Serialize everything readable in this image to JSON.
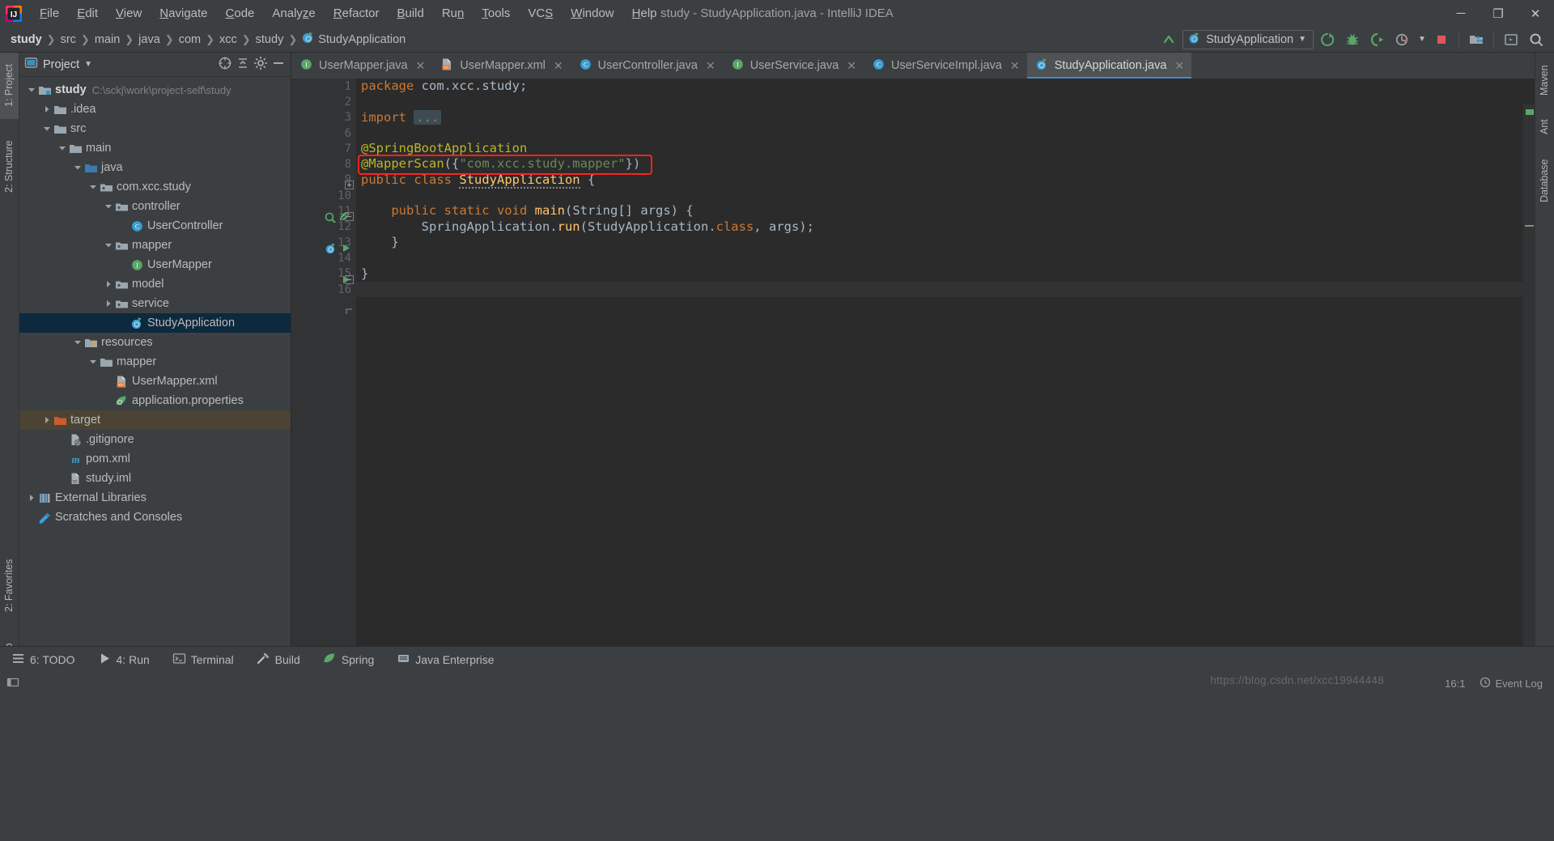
{
  "window": {
    "title": "study - StudyApplication.java - IntelliJ IDEA",
    "minimize": "─",
    "maximize": "❐",
    "close": "✕"
  },
  "menu": [
    {
      "label": "File",
      "mnemonic": "F"
    },
    {
      "label": "Edit",
      "mnemonic": "E"
    },
    {
      "label": "View",
      "mnemonic": "V"
    },
    {
      "label": "Navigate",
      "mnemonic": "N"
    },
    {
      "label": "Code",
      "mnemonic": "C"
    },
    {
      "label": "Analyze",
      "mnemonic": "z"
    },
    {
      "label": "Refactor",
      "mnemonic": "R"
    },
    {
      "label": "Build",
      "mnemonic": "B"
    },
    {
      "label": "Run",
      "mnemonic": "n"
    },
    {
      "label": "Tools",
      "mnemonic": "T"
    },
    {
      "label": "VCS",
      "mnemonic": "S"
    },
    {
      "label": "Window",
      "mnemonic": "W"
    },
    {
      "label": "Help",
      "mnemonic": "H"
    }
  ],
  "breadcrumbs": [
    {
      "label": "study",
      "icon": ""
    },
    {
      "label": "src",
      "icon": ""
    },
    {
      "label": "main",
      "icon": ""
    },
    {
      "label": "java",
      "icon": ""
    },
    {
      "label": "com",
      "icon": ""
    },
    {
      "label": "xcc",
      "icon": ""
    },
    {
      "label": "study",
      "icon": ""
    },
    {
      "label": "StudyApplication",
      "icon": "spring-boot-class-icon"
    }
  ],
  "toolbar": {
    "run_config": "StudyApplication",
    "icons": [
      {
        "name": "update-project-icon"
      },
      {
        "name": "run-icon"
      },
      {
        "name": "debug-icon"
      },
      {
        "name": "run-with-coverage-icon"
      },
      {
        "name": "profiler-icon"
      },
      {
        "name": "stop-icon"
      },
      {
        "name": "project-structure-icon"
      },
      {
        "name": "hide-windows-icon"
      },
      {
        "name": "search-everywhere-icon"
      }
    ]
  },
  "left_stripe": [
    {
      "label": "1: Project",
      "active": true
    },
    {
      "label": "2: Structure",
      "active": false
    },
    {
      "label": "2: Favorites",
      "active": false
    },
    {
      "label": "Web",
      "active": false
    }
  ],
  "right_stripe": [
    {
      "label": "Maven"
    },
    {
      "label": "Ant"
    },
    {
      "label": "Database"
    }
  ],
  "project_panel": {
    "title": "Project",
    "header_icons": [
      {
        "name": "select-opened-file-icon"
      },
      {
        "name": "collapse-all-icon"
      },
      {
        "name": "settings-gear-icon"
      },
      {
        "name": "hide-panel-icon"
      }
    ],
    "tree": [
      {
        "label": "study",
        "path": "C:\\sckj\\work\\project-self\\study",
        "indent": 0,
        "arrow": "open",
        "icon": "module-folder-icon",
        "bold": true,
        "state": "normal"
      },
      {
        "label": ".idea",
        "path": "",
        "indent": 1,
        "arrow": "closed",
        "icon": "folder-icon",
        "bold": false,
        "state": "normal"
      },
      {
        "label": "src",
        "path": "",
        "indent": 1,
        "arrow": "open",
        "icon": "folder-icon",
        "bold": false,
        "state": "normal"
      },
      {
        "label": "main",
        "path": "",
        "indent": 2,
        "arrow": "open",
        "icon": "folder-icon",
        "bold": false,
        "state": "normal"
      },
      {
        "label": "java",
        "path": "",
        "indent": 3,
        "arrow": "open",
        "icon": "source-root-icon",
        "bold": false,
        "state": "normal"
      },
      {
        "label": "com.xcc.study",
        "path": "",
        "indent": 4,
        "arrow": "open",
        "icon": "package-icon",
        "bold": false,
        "state": "normal"
      },
      {
        "label": "controller",
        "path": "",
        "indent": 5,
        "arrow": "open",
        "icon": "package-icon",
        "bold": false,
        "state": "normal"
      },
      {
        "label": "UserController",
        "path": "",
        "indent": 6,
        "arrow": "none",
        "icon": "class-icon",
        "bold": false,
        "state": "normal"
      },
      {
        "label": "mapper",
        "path": "",
        "indent": 5,
        "arrow": "open",
        "icon": "package-icon",
        "bold": false,
        "state": "normal"
      },
      {
        "label": "UserMapper",
        "path": "",
        "indent": 6,
        "arrow": "none",
        "icon": "interface-icon",
        "bold": false,
        "state": "normal"
      },
      {
        "label": "model",
        "path": "",
        "indent": 5,
        "arrow": "closed",
        "icon": "package-icon",
        "bold": false,
        "state": "normal"
      },
      {
        "label": "service",
        "path": "",
        "indent": 5,
        "arrow": "closed",
        "icon": "package-icon",
        "bold": false,
        "state": "normal"
      },
      {
        "label": "StudyApplication",
        "path": "",
        "indent": 6,
        "arrow": "none",
        "icon": "spring-boot-class-icon",
        "bold": false,
        "state": "selected"
      },
      {
        "label": "resources",
        "path": "",
        "indent": 3,
        "arrow": "open",
        "icon": "resource-root-icon",
        "bold": false,
        "state": "normal"
      },
      {
        "label": "mapper",
        "path": "",
        "indent": 4,
        "arrow": "open",
        "icon": "folder-icon",
        "bold": false,
        "state": "normal"
      },
      {
        "label": "UserMapper.xml",
        "path": "",
        "indent": 5,
        "arrow": "none",
        "icon": "xml-file-icon",
        "bold": false,
        "state": "normal"
      },
      {
        "label": "application.properties",
        "path": "",
        "indent": 5,
        "arrow": "none",
        "icon": "spring-properties-icon",
        "bold": false,
        "state": "normal"
      },
      {
        "label": "target",
        "path": "",
        "indent": 1,
        "arrow": "closed",
        "icon": "excluded-folder-icon",
        "bold": false,
        "state": "excluded"
      },
      {
        "label": ".gitignore",
        "path": "",
        "indent": 2,
        "arrow": "none",
        "icon": "gitignore-file-icon",
        "bold": false,
        "state": "normal"
      },
      {
        "label": "pom.xml",
        "path": "",
        "indent": 2,
        "arrow": "none",
        "icon": "maven-file-icon",
        "bold": false,
        "state": "normal"
      },
      {
        "label": "study.iml",
        "path": "",
        "indent": 2,
        "arrow": "none",
        "icon": "iml-file-icon",
        "bold": false,
        "state": "normal"
      },
      {
        "label": "External Libraries",
        "path": "",
        "indent": 0,
        "arrow": "closed",
        "icon": "libraries-icon",
        "bold": false,
        "state": "normal"
      },
      {
        "label": "Scratches and Consoles",
        "path": "",
        "indent": 0,
        "arrow": "none",
        "icon": "scratches-icon",
        "bold": false,
        "state": "normal"
      }
    ]
  },
  "tabs": [
    {
      "label": "UserMapper.java",
      "icon": "interface-icon",
      "active": false
    },
    {
      "label": "UserMapper.xml",
      "icon": "xml-file-icon",
      "active": false
    },
    {
      "label": "UserController.java",
      "icon": "class-icon",
      "active": false
    },
    {
      "label": "UserService.java",
      "icon": "interface-icon",
      "active": false
    },
    {
      "label": "UserServiceImpl.java",
      "icon": "class-icon",
      "active": false
    },
    {
      "label": "StudyApplication.java",
      "icon": "spring-boot-class-icon",
      "active": true
    }
  ],
  "editor": {
    "line_numbers": [
      "1",
      "2",
      "3",
      "6",
      "7",
      "8",
      "9",
      "10",
      "11",
      "12",
      "13",
      "14",
      "15",
      "16"
    ],
    "lines": [
      {
        "n": "1",
        "tokens": [
          {
            "t": "package",
            "c": "kw"
          },
          {
            "t": " com.xcc.study;",
            "c": "plain"
          }
        ]
      },
      {
        "n": "2",
        "tokens": []
      },
      {
        "n": "3",
        "tokens": [
          {
            "t": "import",
            "c": "kw"
          },
          {
            "t": " ",
            "c": "plain"
          },
          {
            "t": "...",
            "c": "folded"
          }
        ]
      },
      {
        "n": "6",
        "tokens": []
      },
      {
        "n": "7",
        "tokens": [
          {
            "t": "@SpringBootApplication",
            "c": "anno"
          }
        ]
      },
      {
        "n": "8",
        "tokens": [
          {
            "t": "@MapperScan",
            "c": "anno"
          },
          {
            "t": "({",
            "c": "plain"
          },
          {
            "t": "\"com.xcc.study.mapper\"",
            "c": "str"
          },
          {
            "t": "})",
            "c": "plain"
          }
        ]
      },
      {
        "n": "9",
        "tokens": [
          {
            "t": "public class",
            "c": "kw"
          },
          {
            "t": " ",
            "c": "plain"
          },
          {
            "t": "StudyApplication",
            "c": "kw2"
          },
          {
            "t": " {",
            "c": "plain"
          }
        ]
      },
      {
        "n": "10",
        "tokens": []
      },
      {
        "n": "11",
        "tokens": [
          {
            "t": "    ",
            "c": "plain"
          },
          {
            "t": "public static void",
            "c": "kw"
          },
          {
            "t": " ",
            "c": "plain"
          },
          {
            "t": "main",
            "c": "kw2"
          },
          {
            "t": "(",
            "c": "plain"
          },
          {
            "t": "String",
            "c": "cls"
          },
          {
            "t": "[] ",
            "c": "plain"
          },
          {
            "t": "args",
            "c": "param"
          },
          {
            "t": ") {",
            "c": "plain"
          }
        ]
      },
      {
        "n": "12",
        "tokens": [
          {
            "t": "        SpringApplication.",
            "c": "plain"
          },
          {
            "t": "run",
            "c": "kw2"
          },
          {
            "t": "(StudyApplication.",
            "c": "plain"
          },
          {
            "t": "class",
            "c": "kw"
          },
          {
            "t": ", ",
            "c": "plain"
          },
          {
            "t": "args",
            "c": "param"
          },
          {
            "t": ");",
            "c": "plain"
          }
        ]
      },
      {
        "n": "13",
        "tokens": [
          {
            "t": "    }",
            "c": "plain"
          }
        ]
      },
      {
        "n": "14",
        "tokens": []
      },
      {
        "n": "15",
        "tokens": [
          {
            "t": "}",
            "c": "plain"
          }
        ]
      },
      {
        "n": "16",
        "tokens": []
      }
    ],
    "annotation": {
      "name": "red-highlight-box",
      "color": "#ff2222",
      "target_line": "8"
    },
    "folded_text": "...",
    "caret_line_index": 13
  },
  "bottom_bar": [
    {
      "label": "6: TODO",
      "icon": "todo-icon"
    },
    {
      "label": "4: Run",
      "icon": "run-icon"
    },
    {
      "label": "Terminal",
      "icon": "terminal-icon"
    },
    {
      "label": "Build",
      "icon": "build-hammer-icon"
    },
    {
      "label": "Spring",
      "icon": "spring-leaf-icon"
    },
    {
      "label": "Java Enterprise",
      "icon": "java-enterprise-icon"
    }
  ],
  "status_bar": {
    "caret_position": "16:1",
    "event_log": "Event Log",
    "watermark": "https://blog.csdn.net/xcc19944448"
  },
  "colors": {
    "accent_blue": "#4a88c7",
    "selection_blue": "#0d293e",
    "excluded_brown": "#4b4434",
    "panel_bg": "#3c3f41",
    "editor_bg": "#2b2b2b",
    "annotation_red": "#ff2222",
    "string_green": "#6a8759",
    "keyword_orange": "#cc7832",
    "annotation_yellow": "#bbb529"
  }
}
